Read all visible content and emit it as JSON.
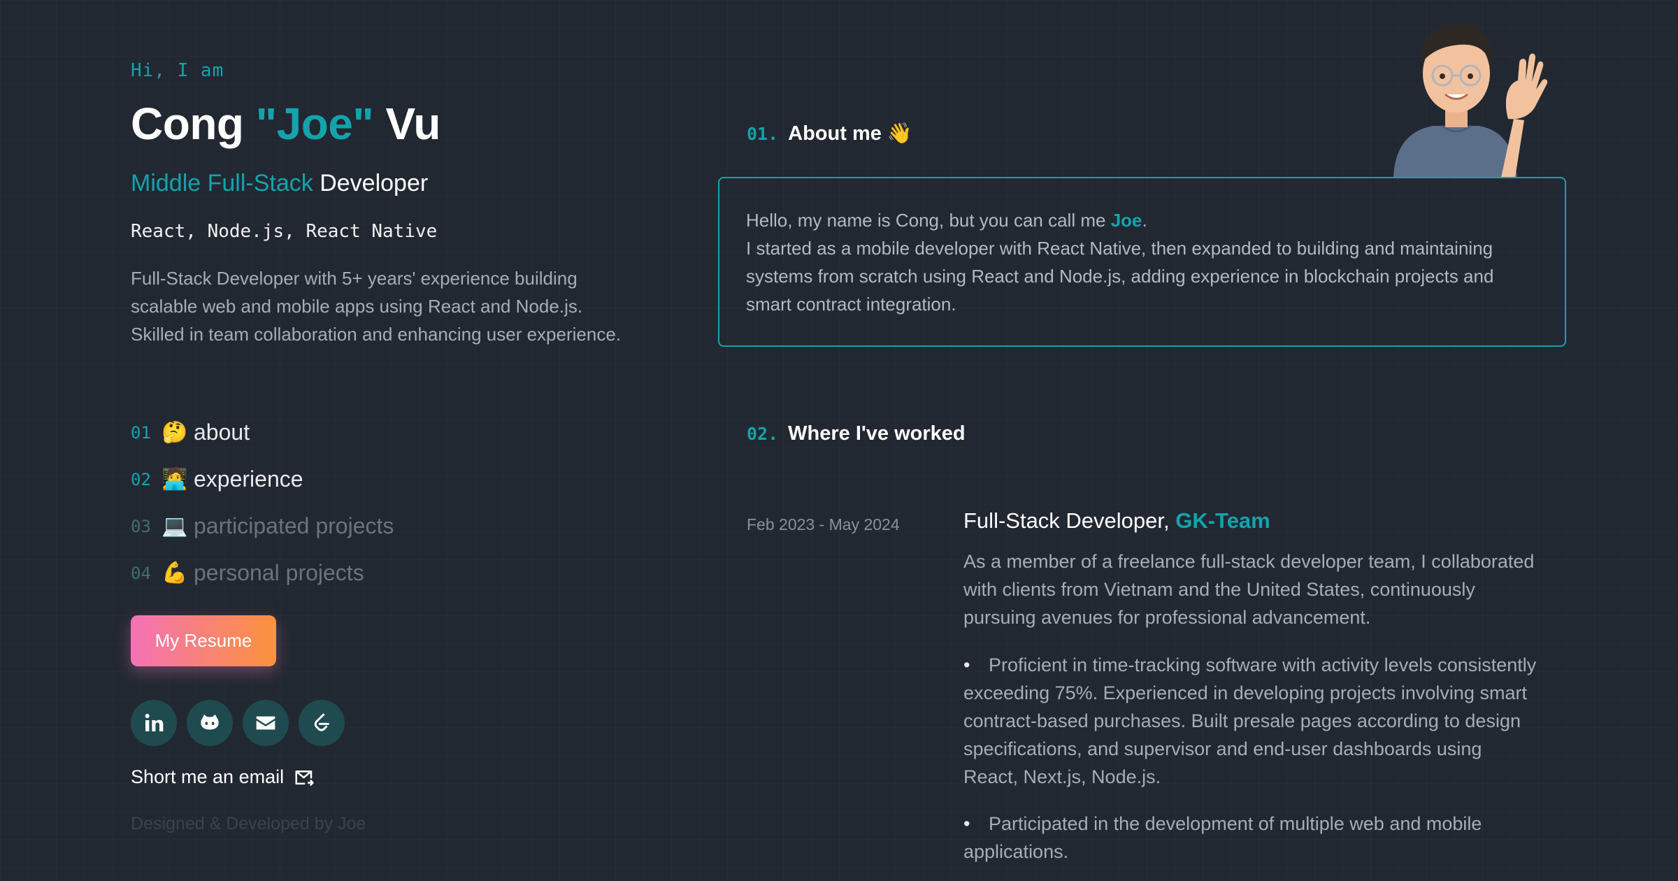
{
  "hero": {
    "greeting": "Hi, I am",
    "first_name": "Cong ",
    "nickname": "\"Joe\"",
    "last_name": " Vu",
    "role_level": "Middle Full-Stack",
    "role_title": " Developer",
    "stack": "React, Node.js, React Native",
    "summary": "Full-Stack Developer with 5+ years' experience building scalable web and mobile apps using React and Node.js. Skilled in team collaboration and enhancing user experience."
  },
  "nav": {
    "items": [
      {
        "num": "01",
        "emoji": "🤔",
        "label": "about",
        "active": true
      },
      {
        "num": "02",
        "emoji": "🧑‍💻",
        "label": "experience",
        "active": true
      },
      {
        "num": "03",
        "emoji": "💻",
        "label": "participated projects",
        "active": false
      },
      {
        "num": "04",
        "emoji": "💪",
        "label": "personal projects",
        "active": false
      }
    ]
  },
  "resume_button": {
    "label": "My Resume"
  },
  "socials": {
    "icons": [
      "linkedin-icon",
      "github-icon",
      "mail-icon",
      "leetcode-icon"
    ]
  },
  "email_link": {
    "label": "Short me an email"
  },
  "footer": {
    "credit": "Designed & Developed by Joe"
  },
  "about": {
    "num": "01.",
    "title": "About me 👋",
    "line1_prefix": "Hello, my name is Cong, but you can call me ",
    "line1_highlight": "Joe",
    "line1_suffix": ".",
    "paragraph": "I started as a mobile developer with React Native, then expanded to building and maintaining systems from scratch using React and Node.js, adding experience in blockchain projects and smart contract integration."
  },
  "work": {
    "num": "02.",
    "title": "Where I've worked",
    "job": {
      "date": "Feb 2023 - May 2024",
      "title": "Full-Stack Developer, ",
      "company": "GK-Team",
      "description": "As a member of a freelance full-stack developer team, I collaborated with clients from Vietnam and the United States, continuously pursuing avenues for professional advancement.",
      "bullets": [
        "Proficient in time-tracking software with activity levels consistently exceeding 75%. Experienced in developing projects involving smart contract-based purchases. Built presale pages according to design specifications, and supervisor and end-user dashboards using React, Next.js, Node.js.",
        "Participated in the development of multiple web and mobile applications."
      ]
    }
  },
  "colors": {
    "background": "#222831",
    "accent": "#14a3ad",
    "resume_gradient_start": "#f472b6",
    "resume_gradient_end": "#fb923c"
  }
}
